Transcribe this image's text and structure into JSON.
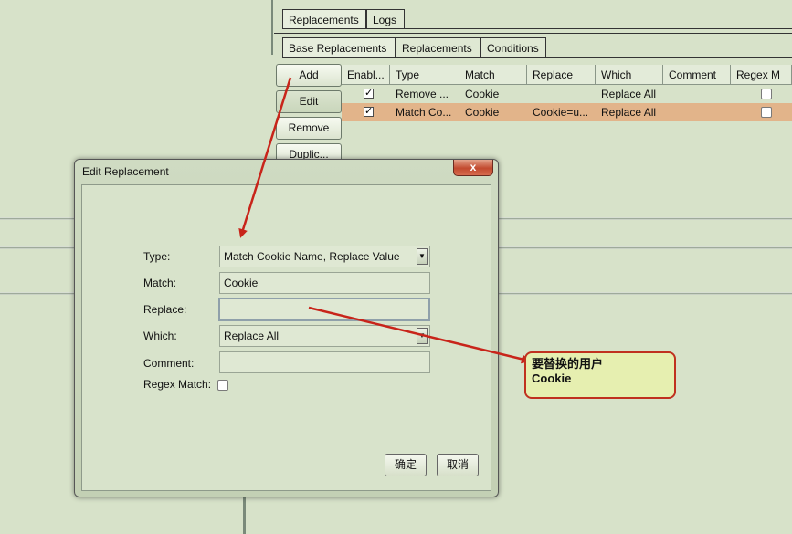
{
  "top_tabs": [
    "Replacements",
    "Logs"
  ],
  "sub_tabs": [
    "Base Replacements",
    "Replacements",
    "Conditions"
  ],
  "side_buttons": {
    "add": "Add",
    "edit": "Edit",
    "remove": "Remove",
    "duplicate": "Duplic..."
  },
  "table": {
    "columns": [
      "Enabl...",
      "Type",
      "Match",
      "Replace",
      "Which",
      "Comment",
      "Regex M"
    ],
    "rows": [
      {
        "enabled": true,
        "type": "Remove ...",
        "match": "Cookie",
        "replace": "",
        "which": "Replace All",
        "comment": "",
        "regex": false,
        "selected": false
      },
      {
        "enabled": true,
        "type": "Match Co...",
        "match": "Cookie",
        "replace": "Cookie=u...",
        "which": "Replace All",
        "comment": "",
        "regex": false,
        "selected": true
      }
    ],
    "selected_row_color": "#e2b48a"
  },
  "dialog": {
    "title": "Edit Replacement",
    "close_label": "x",
    "type_label": "Type:",
    "type_value": "Match Cookie Name, Replace Value",
    "match_label": "Match:",
    "match_value": "Cookie",
    "replace_label": "Replace:",
    "replace_value": "",
    "which_label": "Which:",
    "which_value": "Replace All",
    "comment_label": "Comment:",
    "comment_value": "",
    "regex_label": "Regex Match:",
    "regex_checked": false,
    "ok_label": "确定",
    "cancel_label": "取消"
  },
  "callout": {
    "line1": "要替换的用户",
    "line2": "Cookie"
  },
  "colors": {
    "arrow": "#c8241a",
    "background": "#d7e2c9",
    "callout_bg": "#e6efb0"
  }
}
